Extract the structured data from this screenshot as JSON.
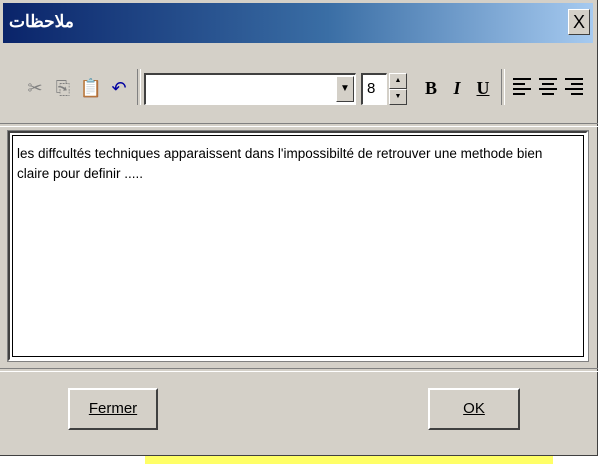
{
  "window": {
    "title": "ملاحظات",
    "close_label": "X"
  },
  "toolbar": {
    "cut_icon": "scissors-icon",
    "copy_icon": "copy-icon",
    "paste_icon": "paste-icon",
    "undo_icon": "undo-icon",
    "font_value": "",
    "font_size": "8",
    "bold_label": "B",
    "italic_label": "I",
    "underline_label": "U"
  },
  "memo": {
    "text": "les diffcultés techniques apparaissent dans l'impossibilté de retrouver une methode bien claire pour definir ....."
  },
  "buttons": {
    "close_label": "Fermer",
    "ok_label": "OK"
  },
  "colors": {
    "title_start": "#0a246a",
    "title_end": "#a6caf0",
    "face": "#d4d0c8"
  }
}
